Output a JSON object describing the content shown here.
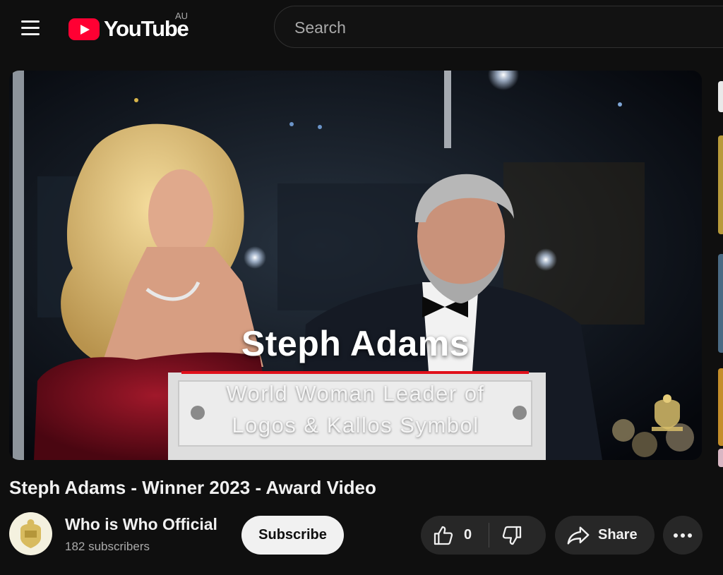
{
  "header": {
    "logo_text": "YouTube",
    "country_code": "AU",
    "search_placeholder": "Search"
  },
  "player": {
    "caption_name": "Steph Adams",
    "caption_line1": "World Woman Leader of",
    "caption_line2": "Logos & Kallos Symbol"
  },
  "video": {
    "title": "Steph Adams - Winner 2023 - Award Video"
  },
  "owner": {
    "channel_name": "Who is Who Official",
    "subscribers": "182 subscribers",
    "subscribe_label": "Subscribe"
  },
  "actions": {
    "like_count": "0",
    "share_label": "Share"
  },
  "colors": {
    "background": "#0f0f0f",
    "brand_red": "#ff0033",
    "pill": "#272727"
  },
  "icons": [
    "menu-icon",
    "youtube-logo-icon",
    "like-icon",
    "dislike-icon",
    "share-icon",
    "more-icon"
  ]
}
